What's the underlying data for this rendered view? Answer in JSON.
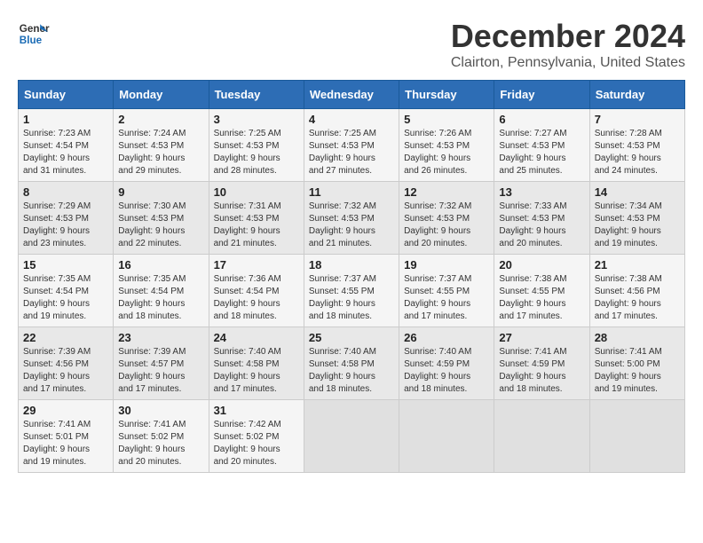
{
  "logo": {
    "line1": "General",
    "line2": "Blue"
  },
  "title": "December 2024",
  "location": "Clairton, Pennsylvania, United States",
  "days_of_week": [
    "Sunday",
    "Monday",
    "Tuesday",
    "Wednesday",
    "Thursday",
    "Friday",
    "Saturday"
  ],
  "weeks": [
    [
      {
        "day": "1",
        "info": "Sunrise: 7:23 AM\nSunset: 4:54 PM\nDaylight: 9 hours\nand 31 minutes."
      },
      {
        "day": "2",
        "info": "Sunrise: 7:24 AM\nSunset: 4:53 PM\nDaylight: 9 hours\nand 29 minutes."
      },
      {
        "day": "3",
        "info": "Sunrise: 7:25 AM\nSunset: 4:53 PM\nDaylight: 9 hours\nand 28 minutes."
      },
      {
        "day": "4",
        "info": "Sunrise: 7:25 AM\nSunset: 4:53 PM\nDaylight: 9 hours\nand 27 minutes."
      },
      {
        "day": "5",
        "info": "Sunrise: 7:26 AM\nSunset: 4:53 PM\nDaylight: 9 hours\nand 26 minutes."
      },
      {
        "day": "6",
        "info": "Sunrise: 7:27 AM\nSunset: 4:53 PM\nDaylight: 9 hours\nand 25 minutes."
      },
      {
        "day": "7",
        "info": "Sunrise: 7:28 AM\nSunset: 4:53 PM\nDaylight: 9 hours\nand 24 minutes."
      }
    ],
    [
      {
        "day": "8",
        "info": "Sunrise: 7:29 AM\nSunset: 4:53 PM\nDaylight: 9 hours\nand 23 minutes."
      },
      {
        "day": "9",
        "info": "Sunrise: 7:30 AM\nSunset: 4:53 PM\nDaylight: 9 hours\nand 22 minutes."
      },
      {
        "day": "10",
        "info": "Sunrise: 7:31 AM\nSunset: 4:53 PM\nDaylight: 9 hours\nand 21 minutes."
      },
      {
        "day": "11",
        "info": "Sunrise: 7:32 AM\nSunset: 4:53 PM\nDaylight: 9 hours\nand 21 minutes."
      },
      {
        "day": "12",
        "info": "Sunrise: 7:32 AM\nSunset: 4:53 PM\nDaylight: 9 hours\nand 20 minutes."
      },
      {
        "day": "13",
        "info": "Sunrise: 7:33 AM\nSunset: 4:53 PM\nDaylight: 9 hours\nand 20 minutes."
      },
      {
        "day": "14",
        "info": "Sunrise: 7:34 AM\nSunset: 4:53 PM\nDaylight: 9 hours\nand 19 minutes."
      }
    ],
    [
      {
        "day": "15",
        "info": "Sunrise: 7:35 AM\nSunset: 4:54 PM\nDaylight: 9 hours\nand 19 minutes."
      },
      {
        "day": "16",
        "info": "Sunrise: 7:35 AM\nSunset: 4:54 PM\nDaylight: 9 hours\nand 18 minutes."
      },
      {
        "day": "17",
        "info": "Sunrise: 7:36 AM\nSunset: 4:54 PM\nDaylight: 9 hours\nand 18 minutes."
      },
      {
        "day": "18",
        "info": "Sunrise: 7:37 AM\nSunset: 4:55 PM\nDaylight: 9 hours\nand 18 minutes."
      },
      {
        "day": "19",
        "info": "Sunrise: 7:37 AM\nSunset: 4:55 PM\nDaylight: 9 hours\nand 17 minutes."
      },
      {
        "day": "20",
        "info": "Sunrise: 7:38 AM\nSunset: 4:55 PM\nDaylight: 9 hours\nand 17 minutes."
      },
      {
        "day": "21",
        "info": "Sunrise: 7:38 AM\nSunset: 4:56 PM\nDaylight: 9 hours\nand 17 minutes."
      }
    ],
    [
      {
        "day": "22",
        "info": "Sunrise: 7:39 AM\nSunset: 4:56 PM\nDaylight: 9 hours\nand 17 minutes."
      },
      {
        "day": "23",
        "info": "Sunrise: 7:39 AM\nSunset: 4:57 PM\nDaylight: 9 hours\nand 17 minutes."
      },
      {
        "day": "24",
        "info": "Sunrise: 7:40 AM\nSunset: 4:58 PM\nDaylight: 9 hours\nand 17 minutes."
      },
      {
        "day": "25",
        "info": "Sunrise: 7:40 AM\nSunset: 4:58 PM\nDaylight: 9 hours\nand 18 minutes."
      },
      {
        "day": "26",
        "info": "Sunrise: 7:40 AM\nSunset: 4:59 PM\nDaylight: 9 hours\nand 18 minutes."
      },
      {
        "day": "27",
        "info": "Sunrise: 7:41 AM\nSunset: 4:59 PM\nDaylight: 9 hours\nand 18 minutes."
      },
      {
        "day": "28",
        "info": "Sunrise: 7:41 AM\nSunset: 5:00 PM\nDaylight: 9 hours\nand 19 minutes."
      }
    ],
    [
      {
        "day": "29",
        "info": "Sunrise: 7:41 AM\nSunset: 5:01 PM\nDaylight: 9 hours\nand 19 minutes."
      },
      {
        "day": "30",
        "info": "Sunrise: 7:41 AM\nSunset: 5:02 PM\nDaylight: 9 hours\nand 20 minutes."
      },
      {
        "day": "31",
        "info": "Sunrise: 7:42 AM\nSunset: 5:02 PM\nDaylight: 9 hours\nand 20 minutes."
      },
      {
        "day": "",
        "info": ""
      },
      {
        "day": "",
        "info": ""
      },
      {
        "day": "",
        "info": ""
      },
      {
        "day": "",
        "info": ""
      }
    ]
  ]
}
